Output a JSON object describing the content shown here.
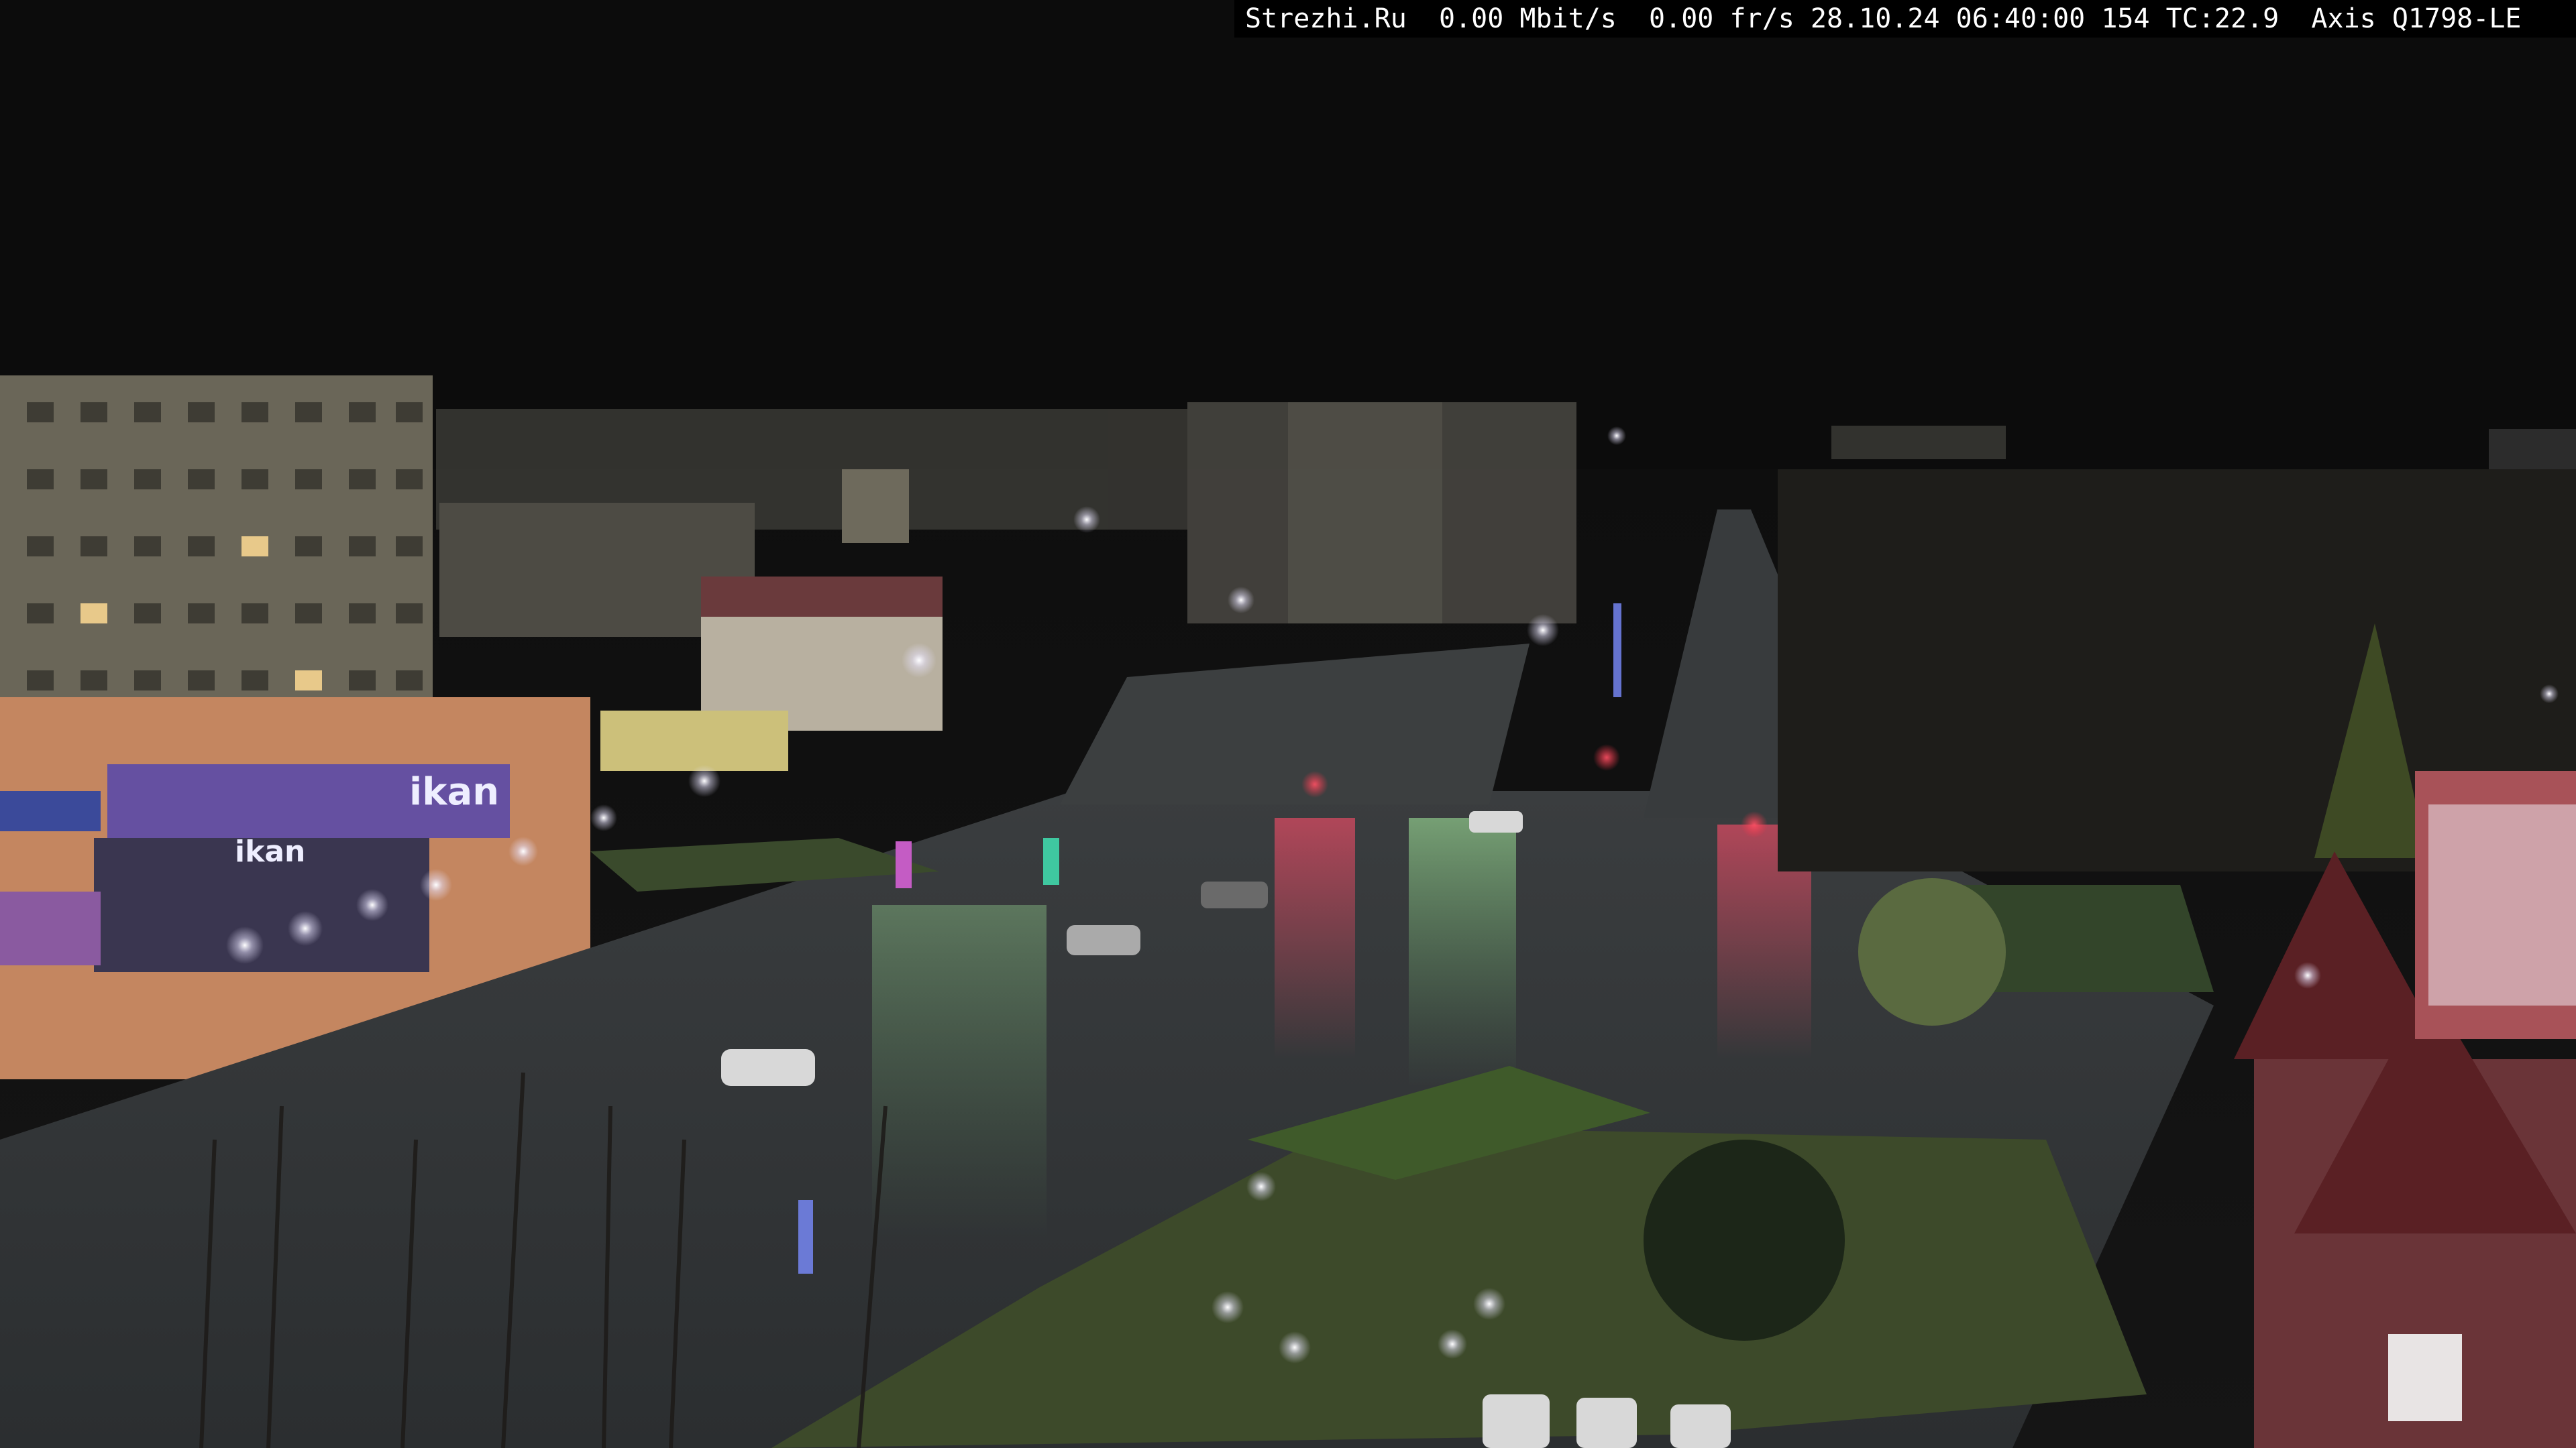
{
  "overlay": {
    "text": "Strezhi.Ru  0.00 Mbit/s  0.00 fr/s 28.10.24 06:40:00 154 TC:22.9  Axis Q1798-LE"
  },
  "signs": {
    "store_main": "ikan",
    "store_lower": "ikan"
  },
  "colors": {
    "sky": "#0c0c0c",
    "street_light": "#f4f1e6",
    "sign_glow": "#8f7cff",
    "traffic_red": "#ff3347",
    "green_reflection": "#8fe08a"
  }
}
